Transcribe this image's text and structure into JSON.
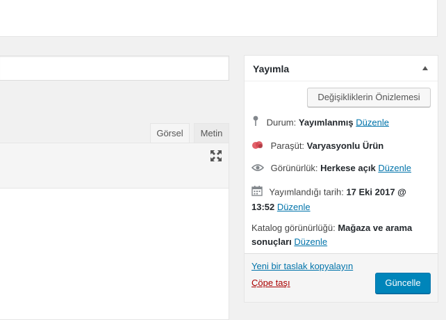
{
  "editor": {
    "tabs": [
      {
        "label": "Görsel"
      },
      {
        "label": "Metin"
      }
    ]
  },
  "publish": {
    "title": "Yayımla",
    "preview_button": "Değişikliklerin Önizlemesi",
    "status": {
      "label": "Durum:",
      "value": "Yayımlanmış",
      "edit": "Düzenle"
    },
    "parent": {
      "label": "Paraşüt:",
      "value": "Varyasyonlu Ürün"
    },
    "visibility": {
      "label": "Görünürlük:",
      "value": "Herkese açık",
      "edit": "Düzenle"
    },
    "published_on": {
      "label": "Yayımlandığı tarih:",
      "value_line1": "17 Eki 2017 @",
      "value_line2": "13:52",
      "edit": "Düzenle"
    },
    "catalog": {
      "label": "Katalog görünürlüğü:",
      "value_line1": "Mağaza ve arama",
      "value_line2": "sonuçları",
      "edit": "Düzenle"
    },
    "copy_draft": "Yeni bir taslak kopyalayın",
    "trash": "Çöpe taşı",
    "update_button": "Güncelle"
  },
  "colors": {
    "accent": "#0085ba",
    "link": "#0073aa",
    "trash": "#aa0000"
  },
  "icons": {
    "status": "pin-icon",
    "parent": "parasut-logo-icon",
    "visibility": "eye-icon",
    "date": "calendar-icon",
    "fullscreen": "fullscreen-icon",
    "toggle": "caret-up-icon"
  }
}
